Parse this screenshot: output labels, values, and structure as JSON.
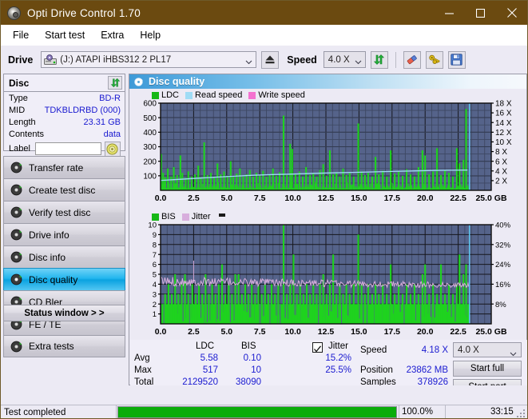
{
  "window": {
    "title": "Opti Drive Control 1.70",
    "icon": "disc-icon",
    "minimize": "minimize",
    "maximize": "maximize",
    "close": "close"
  },
  "menu": {
    "items": [
      {
        "label": "File"
      },
      {
        "label": "Start test"
      },
      {
        "label": "Extra"
      },
      {
        "label": "Help"
      }
    ]
  },
  "toolbar": {
    "drive_label": "Drive",
    "drive_value": "(J:)   ATAPI iHBS312   2 PL17",
    "eject_icon": "eject-icon",
    "speed_label": "Speed",
    "speed_value": "4.0 X",
    "refresh_icon": "refresh-icon",
    "erase_icon": "eraser-icon",
    "bitsetting_icon": "keys-icon",
    "save_icon": "save-icon"
  },
  "disc_panel": {
    "title": "Disc",
    "refresh_icon": "refresh-icon",
    "rows": [
      {
        "key": "Type",
        "value": "BD-R"
      },
      {
        "key": "MID",
        "value": "TDKBLDRBD (000)"
      },
      {
        "key": "Length",
        "value": "23.31 GB"
      },
      {
        "key": "Contents",
        "value": "data"
      }
    ],
    "label_key": "Label",
    "label_value": "",
    "label_placeholder": "",
    "label_button_icon": "disc-icon"
  },
  "nav": {
    "items": [
      {
        "label": "Transfer rate",
        "icon": "disc-test-icon",
        "active": false
      },
      {
        "label": "Create test disc",
        "icon": "disc-test-icon",
        "active": false
      },
      {
        "label": "Verify test disc",
        "icon": "disc-test-icon",
        "active": false
      },
      {
        "label": "Drive info",
        "icon": "disc-test-icon",
        "active": false
      },
      {
        "label": "Disc info",
        "icon": "disc-test-icon",
        "active": false
      },
      {
        "label": "Disc quality",
        "icon": "disc-test-icon",
        "active": true
      },
      {
        "label": "CD Bler",
        "icon": "disc-test-icon",
        "active": false
      },
      {
        "label": "FE / TE",
        "icon": "disc-test-icon",
        "active": false
      },
      {
        "label": "Extra tests",
        "icon": "disc-test-icon",
        "active": false
      }
    ],
    "status_window_label": "Status window > >"
  },
  "content": {
    "header_title": "Disc quality",
    "header_icon": "disc-quality-icon"
  },
  "stats": {
    "col_headers": [
      "LDC",
      "BIS"
    ],
    "row_labels": [
      "Avg",
      "Max",
      "Total"
    ],
    "ldc": {
      "avg": "5.58",
      "max": "517",
      "total": "2129520"
    },
    "bis": {
      "avg": "0.10",
      "max": "10",
      "total": "38090"
    },
    "jitter": {
      "label": "Jitter",
      "checked": true,
      "avg": "15.2%",
      "max": "25.5%"
    },
    "speed_label": "Speed",
    "speed_value": "4.18 X",
    "position_label": "Position",
    "position_value": "23862 MB",
    "samples_label": "Samples",
    "samples_value": "378926",
    "speed_select_value": "4.0 X",
    "start_full_label": "Start full",
    "start_part_label": "Start part"
  },
  "statusbar": {
    "text": "Test completed",
    "progress_percent_label": "100.0%",
    "progress_value": 100,
    "elapsed": "33:15"
  },
  "chart_data": [
    {
      "id": "ldc-chart",
      "type": "line",
      "title": "Disc quality - LDC / Read speed",
      "xlabel": "GB",
      "ylabel": "LDC",
      "xlim": [
        0.0,
        25.0
      ],
      "ylim": [
        0,
        600
      ],
      "y2lim": [
        0,
        18
      ],
      "y2label": "X",
      "grid": true,
      "legend_position": "top-left",
      "xticks": [
        "0.0",
        "2.5",
        "5.0",
        "7.5",
        "10.0",
        "12.5",
        "15.0",
        "17.5",
        "20.0",
        "22.5",
        "25.0 GB"
      ],
      "yticks": [
        100,
        200,
        300,
        400,
        500,
        600
      ],
      "y2ticks": [
        "2 X",
        "4 X",
        "6 X",
        "8 X",
        "10 X",
        "12 X",
        "14 X",
        "16 X",
        "18 X"
      ],
      "series": [
        {
          "name": "LDC",
          "color": "#17b817",
          "kind": "impulse"
        },
        {
          "name": "Read speed",
          "color": "#9fdcf5",
          "kind": "line"
        },
        {
          "name": "Write speed",
          "color": "#f472d0",
          "kind": "line"
        }
      ],
      "ldc_spikes": [
        [
          0.05,
          250
        ],
        [
          0.2,
          120
        ],
        [
          0.35,
          90
        ],
        [
          0.55,
          150
        ],
        [
          0.8,
          95
        ],
        [
          1.0,
          160
        ],
        [
          1.25,
          105
        ],
        [
          1.5,
          240
        ],
        [
          1.65,
          120
        ],
        [
          1.9,
          85
        ],
        [
          2.1,
          130
        ],
        [
          2.35,
          95
        ],
        [
          2.6,
          110
        ],
        [
          2.85,
          170
        ],
        [
          3.05,
          90
        ],
        [
          3.3,
          330
        ],
        [
          3.55,
          105
        ],
        [
          3.8,
          120
        ],
        [
          4.05,
          95
        ],
        [
          4.3,
          185
        ],
        [
          4.55,
          110
        ],
        [
          4.8,
          130
        ],
        [
          5.05,
          100
        ],
        [
          5.3,
          200
        ],
        [
          5.5,
          95
        ],
        [
          5.75,
          115
        ],
        [
          6.0,
          150
        ],
        [
          6.25,
          95
        ],
        [
          6.5,
          110
        ],
        [
          6.75,
          140
        ],
        [
          7.0,
          95
        ],
        [
          7.25,
          120
        ],
        [
          7.5,
          100
        ],
        [
          7.75,
          135
        ],
        [
          8.0,
          95
        ],
        [
          8.25,
          110
        ],
        [
          8.5,
          150
        ],
        [
          8.75,
          100
        ],
        [
          9.0,
          125
        ],
        [
          9.3,
          515
        ],
        [
          9.55,
          105
        ],
        [
          9.8,
          320
        ],
        [
          9.95,
          285
        ],
        [
          10.2,
          110
        ],
        [
          10.5,
          130
        ],
        [
          10.75,
          95
        ],
        [
          11.0,
          160
        ],
        [
          11.3,
          105
        ],
        [
          11.55,
          120
        ],
        [
          11.8,
          95
        ],
        [
          12.05,
          140
        ],
        [
          12.3,
          180
        ],
        [
          12.55,
          100
        ],
        [
          12.8,
          275
        ],
        [
          13.05,
          110
        ],
        [
          13.3,
          125
        ],
        [
          13.55,
          95
        ],
        [
          13.8,
          150
        ],
        [
          14.05,
          105
        ],
        [
          14.3,
          120
        ],
        [
          14.6,
          95
        ],
        [
          14.95,
          460
        ],
        [
          15.2,
          130
        ],
        [
          15.45,
          105
        ],
        [
          15.7,
          120
        ],
        [
          16.0,
          95
        ],
        [
          16.25,
          230
        ],
        [
          16.5,
          110
        ],
        [
          16.8,
          135
        ],
        [
          17.1,
          95
        ],
        [
          17.4,
          275
        ],
        [
          17.7,
          115
        ],
        [
          18.0,
          130
        ],
        [
          18.3,
          100
        ],
        [
          18.6,
          145
        ],
        [
          18.9,
          110
        ],
        [
          19.2,
          95
        ],
        [
          19.5,
          160
        ],
        [
          19.8,
          275
        ],
        [
          20.0,
          240
        ],
        [
          20.3,
          110
        ],
        [
          20.6,
          130
        ],
        [
          20.9,
          290
        ],
        [
          21.2,
          105
        ],
        [
          21.5,
          140
        ],
        [
          21.8,
          120
        ],
        [
          22.1,
          95
        ],
        [
          22.4,
          290
        ],
        [
          22.6,
          185
        ],
        [
          22.9,
          210
        ],
        [
          23.1,
          560
        ]
      ],
      "read_speed_points": [
        [
          0.0,
          2.05
        ],
        [
          1.0,
          2.2
        ],
        [
          2.5,
          2.45
        ],
        [
          4.0,
          2.7
        ],
        [
          5.5,
          2.9
        ],
        [
          7.0,
          3.1
        ],
        [
          8.5,
          3.25
        ],
        [
          10.0,
          3.35
        ],
        [
          11.5,
          3.5
        ],
        [
          13.0,
          3.6
        ],
        [
          14.5,
          3.7
        ],
        [
          16.0,
          3.8
        ],
        [
          17.5,
          3.9
        ],
        [
          19.0,
          4.0
        ],
        [
          20.5,
          4.1
        ],
        [
          22.0,
          4.15
        ],
        [
          23.2,
          4.18
        ]
      ],
      "cursor_x": 23.35
    },
    {
      "id": "bis-chart",
      "type": "line",
      "title": "Disc quality - BIS / Jitter",
      "xlabel": "GB",
      "ylabel": "BIS",
      "xlim": [
        0.0,
        25.0
      ],
      "ylim": [
        0,
        10
      ],
      "y2lim": [
        0,
        40
      ],
      "y2label": "%",
      "grid": true,
      "legend_position": "top-left",
      "xticks": [
        "0.0",
        "2.5",
        "5.0",
        "7.5",
        "10.0",
        "12.5",
        "15.0",
        "17.5",
        "20.0",
        "22.5",
        "25.0 GB"
      ],
      "yticks": [
        1,
        2,
        3,
        4,
        5,
        6,
        7,
        8,
        9,
        10
      ],
      "y2ticks": [
        "8%",
        "16%",
        "24%",
        "32%",
        "40%"
      ],
      "series": [
        {
          "name": "BIS",
          "color": "#17b817",
          "kind": "impulse"
        },
        {
          "name": "Jitter",
          "color": "#d8aedd",
          "kind": "line"
        }
      ],
      "bis_baseline": 2,
      "bis_spikes": [
        [
          0.35,
          3
        ],
        [
          0.6,
          4
        ],
        [
          0.85,
          3
        ],
        [
          1.1,
          5
        ],
        [
          1.35,
          3
        ],
        [
          1.6,
          4
        ],
        [
          1.85,
          5
        ],
        [
          2.1,
          3
        ],
        [
          2.4,
          4
        ],
        [
          2.65,
          3
        ],
        [
          2.9,
          4
        ],
        [
          3.15,
          3
        ],
        [
          3.4,
          5
        ],
        [
          3.65,
          3
        ],
        [
          3.9,
          4
        ],
        [
          4.15,
          3
        ],
        [
          4.4,
          4
        ],
        [
          4.65,
          6
        ],
        [
          4.9,
          3
        ],
        [
          5.15,
          4
        ],
        [
          5.4,
          3
        ],
        [
          5.65,
          5
        ],
        [
          5.9,
          5
        ],
        [
          6.15,
          3
        ],
        [
          6.4,
          4
        ],
        [
          6.65,
          3
        ],
        [
          6.9,
          4
        ],
        [
          7.15,
          3
        ],
        [
          7.4,
          4
        ],
        [
          7.65,
          3
        ],
        [
          7.9,
          4
        ],
        [
          8.15,
          3
        ],
        [
          8.4,
          4
        ],
        [
          8.65,
          3
        ],
        [
          8.9,
          4
        ],
        [
          9.3,
          10
        ],
        [
          9.55,
          3
        ],
        [
          9.8,
          4
        ],
        [
          10.05,
          7
        ],
        [
          10.3,
          3
        ],
        [
          10.55,
          4
        ],
        [
          10.8,
          3
        ],
        [
          11.05,
          4
        ],
        [
          11.3,
          3
        ],
        [
          11.55,
          4
        ],
        [
          11.8,
          3
        ],
        [
          12.05,
          4
        ],
        [
          12.3,
          5
        ],
        [
          12.55,
          3
        ],
        [
          12.8,
          4
        ],
        [
          13.05,
          7
        ],
        [
          13.3,
          3
        ],
        [
          13.55,
          4
        ],
        [
          13.8,
          3
        ],
        [
          14.05,
          4
        ],
        [
          14.3,
          3
        ],
        [
          14.6,
          4
        ],
        [
          14.95,
          9
        ],
        [
          15.2,
          4
        ],
        [
          15.45,
          3
        ],
        [
          15.7,
          4
        ],
        [
          16.0,
          3
        ],
        [
          16.25,
          4
        ],
        [
          16.5,
          3
        ],
        [
          16.8,
          4
        ],
        [
          17.1,
          3
        ],
        [
          17.4,
          6
        ],
        [
          17.7,
          3
        ],
        [
          18.0,
          4
        ],
        [
          18.3,
          3
        ],
        [
          18.6,
          4
        ],
        [
          18.9,
          3
        ],
        [
          19.2,
          4
        ],
        [
          19.5,
          3
        ],
        [
          19.8,
          5
        ],
        [
          20.0,
          6
        ],
        [
          20.3,
          3
        ],
        [
          20.6,
          4
        ],
        [
          20.9,
          3
        ],
        [
          21.2,
          6
        ],
        [
          21.5,
          3
        ],
        [
          21.8,
          4
        ],
        [
          22.1,
          3
        ],
        [
          22.4,
          4
        ],
        [
          22.6,
          7
        ],
        [
          22.9,
          5
        ],
        [
          23.1,
          6
        ]
      ],
      "jitter_mean_percent": 16,
      "cursor_x": 23.35
    }
  ]
}
